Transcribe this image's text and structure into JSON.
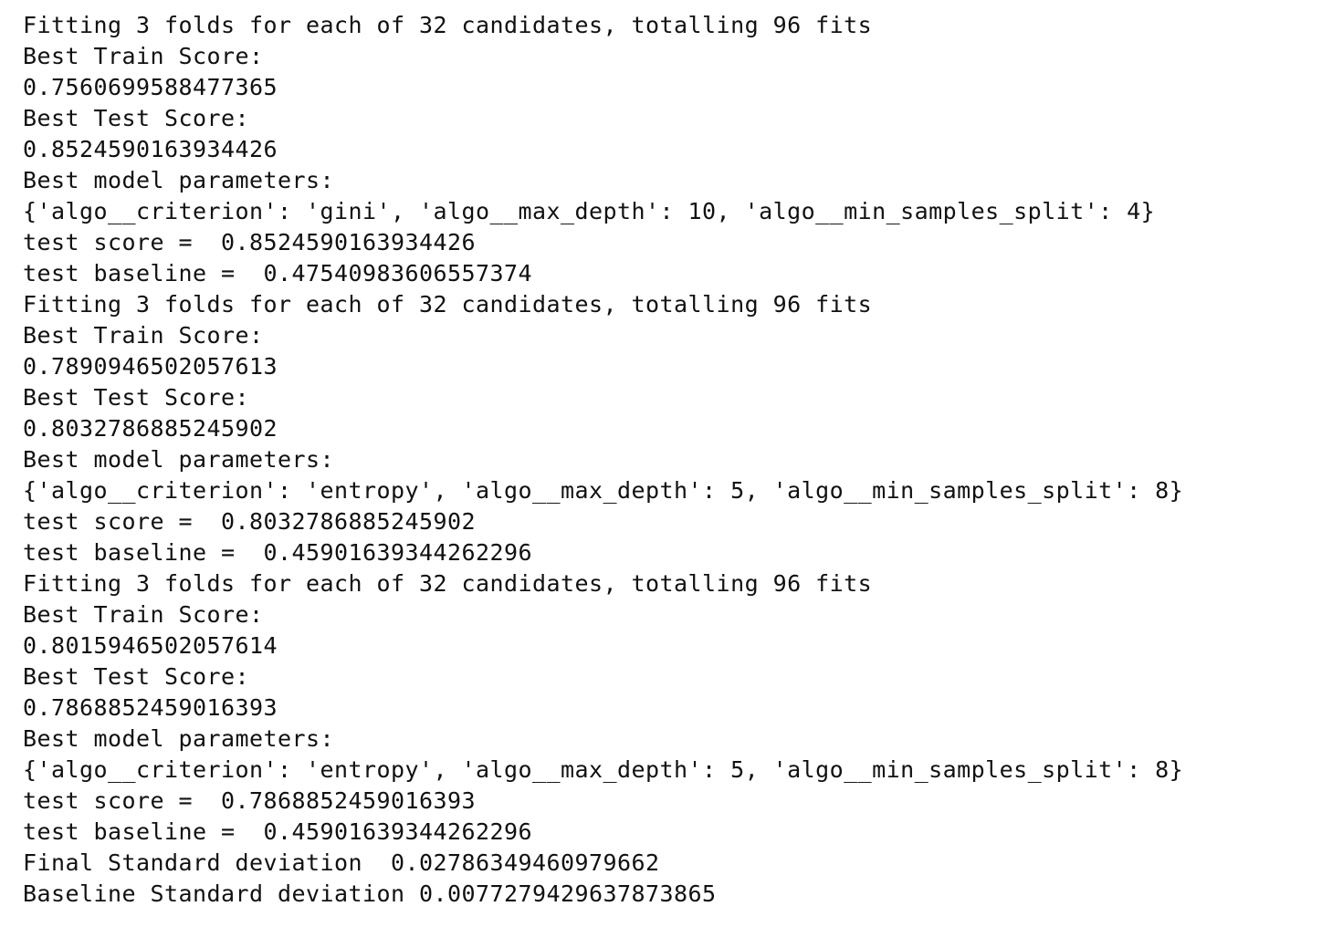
{
  "output": {
    "lines": [
      "Fitting 3 folds for each of 32 candidates, totalling 96 fits",
      "Best Train Score:",
      "0.7560699588477365",
      "Best Test Score:",
      "0.8524590163934426",
      "Best model parameters:",
      "{'algo__criterion': 'gini', 'algo__max_depth': 10, 'algo__min_samples_split': 4}",
      "test score =  0.8524590163934426",
      "test baseline =  0.47540983606557374",
      "Fitting 3 folds for each of 32 candidates, totalling 96 fits",
      "Best Train Score:",
      "0.7890946502057613",
      "Best Test Score:",
      "0.8032786885245902",
      "Best model parameters:",
      "{'algo__criterion': 'entropy', 'algo__max_depth': 5, 'algo__min_samples_split': 8}",
      "test score =  0.8032786885245902",
      "test baseline =  0.45901639344262296",
      "Fitting 3 folds for each of 32 candidates, totalling 96 fits",
      "Best Train Score:",
      "0.8015946502057614",
      "Best Test Score:",
      "0.7868852459016393",
      "Best model parameters:",
      "{'algo__criterion': 'entropy', 'algo__max_depth': 5, 'algo__min_samples_split': 8}",
      "test score =  0.7868852459016393",
      "test baseline =  0.45901639344262296",
      "Final Standard deviation  0.02786349460979662",
      "Baseline Standard deviation 0.007727942963787386​5"
    ]
  }
}
